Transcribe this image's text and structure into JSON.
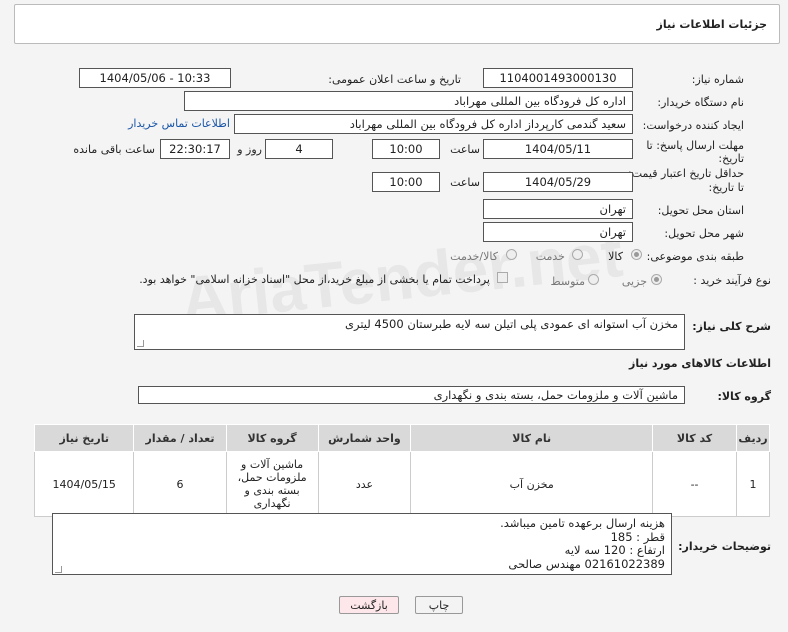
{
  "header": {
    "title": "جزئیات اطلاعات نیاز"
  },
  "form": {
    "need_number_label": "شماره نیاز:",
    "need_number": "1104001493000130",
    "announce_label": "تاریخ و ساعت اعلان عمومی:",
    "announce_value": "1404/05/06 - 10:33",
    "buyer_org_label": "نام دستگاه خریدار:",
    "buyer_org": "اداره کل فرودگاه بین المللی مهراباد",
    "creator_label": "ایجاد کننده درخواست:",
    "creator": "سعید گندمی کارپرداز اداره کل فرودگاه بین المللی مهراباد",
    "contact_link": "اطلاعات تماس خریدار",
    "deadline_label_1": "مهلت ارسال پاسخ: تا",
    "deadline_label_2": "تاریخ:",
    "deadline_date": "1404/05/11",
    "time_label": "ساعت",
    "deadline_time": "10:00",
    "days_value": "4",
    "days_label": "روز و",
    "remaining_time": "22:30:17",
    "remaining_label": "ساعت باقی مانده",
    "min_price_label_1": "حداقل تاریخ اعتبار قیمت:",
    "min_price_label_2": "تا تاریخ:",
    "price_date": "1404/05/29",
    "price_time": "10:00",
    "province_label": "استان محل تحویل:",
    "province": "تهران",
    "city_label": "شهر محل تحویل:",
    "city": "تهران",
    "category_label": "طبقه بندی موضوعی:",
    "category_options": [
      "کالا",
      "خدمت",
      "کالا/خدمت"
    ],
    "process_label": "نوع فرآیند خرید :",
    "process_options": [
      "جزیی",
      "متوسط"
    ],
    "payment_note": "پرداخت تمام یا بخشی از مبلغ خرید،از محل \"اسناد خزانه اسلامی\" خواهد بود.",
    "description_label": "شرح کلی نیاز:",
    "description": "مخزن آب استوانه ای عمودی پلی اتیلن سه لایه طبرستان 4500 لیتری"
  },
  "goods": {
    "section_title": "اطلاعات کالاهای مورد نیاز",
    "group_label": "گروه کالا:",
    "group_value": "ماشین آلات و ملزومات حمل، بسته بندی و نگهداری",
    "table": {
      "headers": [
        "ردیف",
        "کد کالا",
        "نام کالا",
        "واحد شمارش",
        "گروه کالا",
        "تعداد / مقدار",
        "تاریخ نیاز"
      ],
      "rows": [
        [
          "1",
          "--",
          "مخزن آب",
          "عدد",
          "ماشین آلات و ملزومات حمل، بسته بندی و نگهداری",
          "6",
          "1404/05/15"
        ]
      ]
    }
  },
  "buyer_notes": {
    "label": "توضیحات خریدار:",
    "lines": [
      "هزینه ارسال برعهده تامین میباشد.",
      "قطر : 185",
      "ارتفاع : 120 سه لایه",
      "02161022389 مهندس صالحی"
    ]
  },
  "buttons": {
    "print": "چاپ",
    "back": "بازگشت"
  },
  "watermark": "AriaTender.net"
}
